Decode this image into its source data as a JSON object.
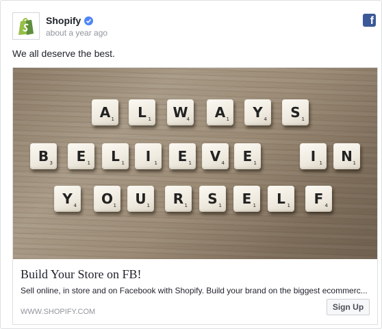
{
  "post": {
    "page_name": "Shopify",
    "timestamp": "about a year ago",
    "message": "We all deserve the best."
  },
  "icons": {
    "avatar": "shopify-bag-logo",
    "verified": "verified-badge-icon",
    "network": "facebook-icon"
  },
  "colors": {
    "facebook_blue": "#3b5998",
    "verified_blue": "#4f86f7",
    "shopify_green": "#95bf47"
  },
  "ad": {
    "image_tiles": {
      "rows": [
        [
          {
            "l": "A",
            "p": "1"
          },
          {
            "l": "L",
            "p": "1"
          },
          {
            "l": "W",
            "p": "4"
          },
          {
            "l": "A",
            "p": "1"
          },
          {
            "l": "Y",
            "p": "4"
          },
          {
            "l": "S",
            "p": "1"
          }
        ],
        [
          {
            "l": "B",
            "p": "3"
          },
          {
            "l": "E",
            "p": "1"
          },
          {
            "l": "L",
            "p": "1"
          },
          {
            "l": "I",
            "p": "1"
          },
          {
            "l": "E",
            "p": "1"
          },
          {
            "l": "V",
            "p": "4"
          },
          {
            "l": "E",
            "p": "1"
          },
          {
            "l": "I",
            "p": "1"
          },
          {
            "l": "N",
            "p": "1"
          }
        ],
        [
          {
            "l": "Y",
            "p": "4"
          },
          {
            "l": "O",
            "p": "1"
          },
          {
            "l": "U",
            "p": "1"
          },
          {
            "l": "R",
            "p": "1"
          },
          {
            "l": "S",
            "p": "1"
          },
          {
            "l": "E",
            "p": "1"
          },
          {
            "l": "L",
            "p": "1"
          },
          {
            "l": "F",
            "p": "4"
          }
        ]
      ]
    },
    "headline": "Build Your Store on FB!",
    "description": "Sell online, in store and on Facebook with Shopify. Build your brand on the biggest ecommerc...",
    "domain": "WWW.SHOPIFY.COM",
    "cta_label": "Sign Up"
  }
}
